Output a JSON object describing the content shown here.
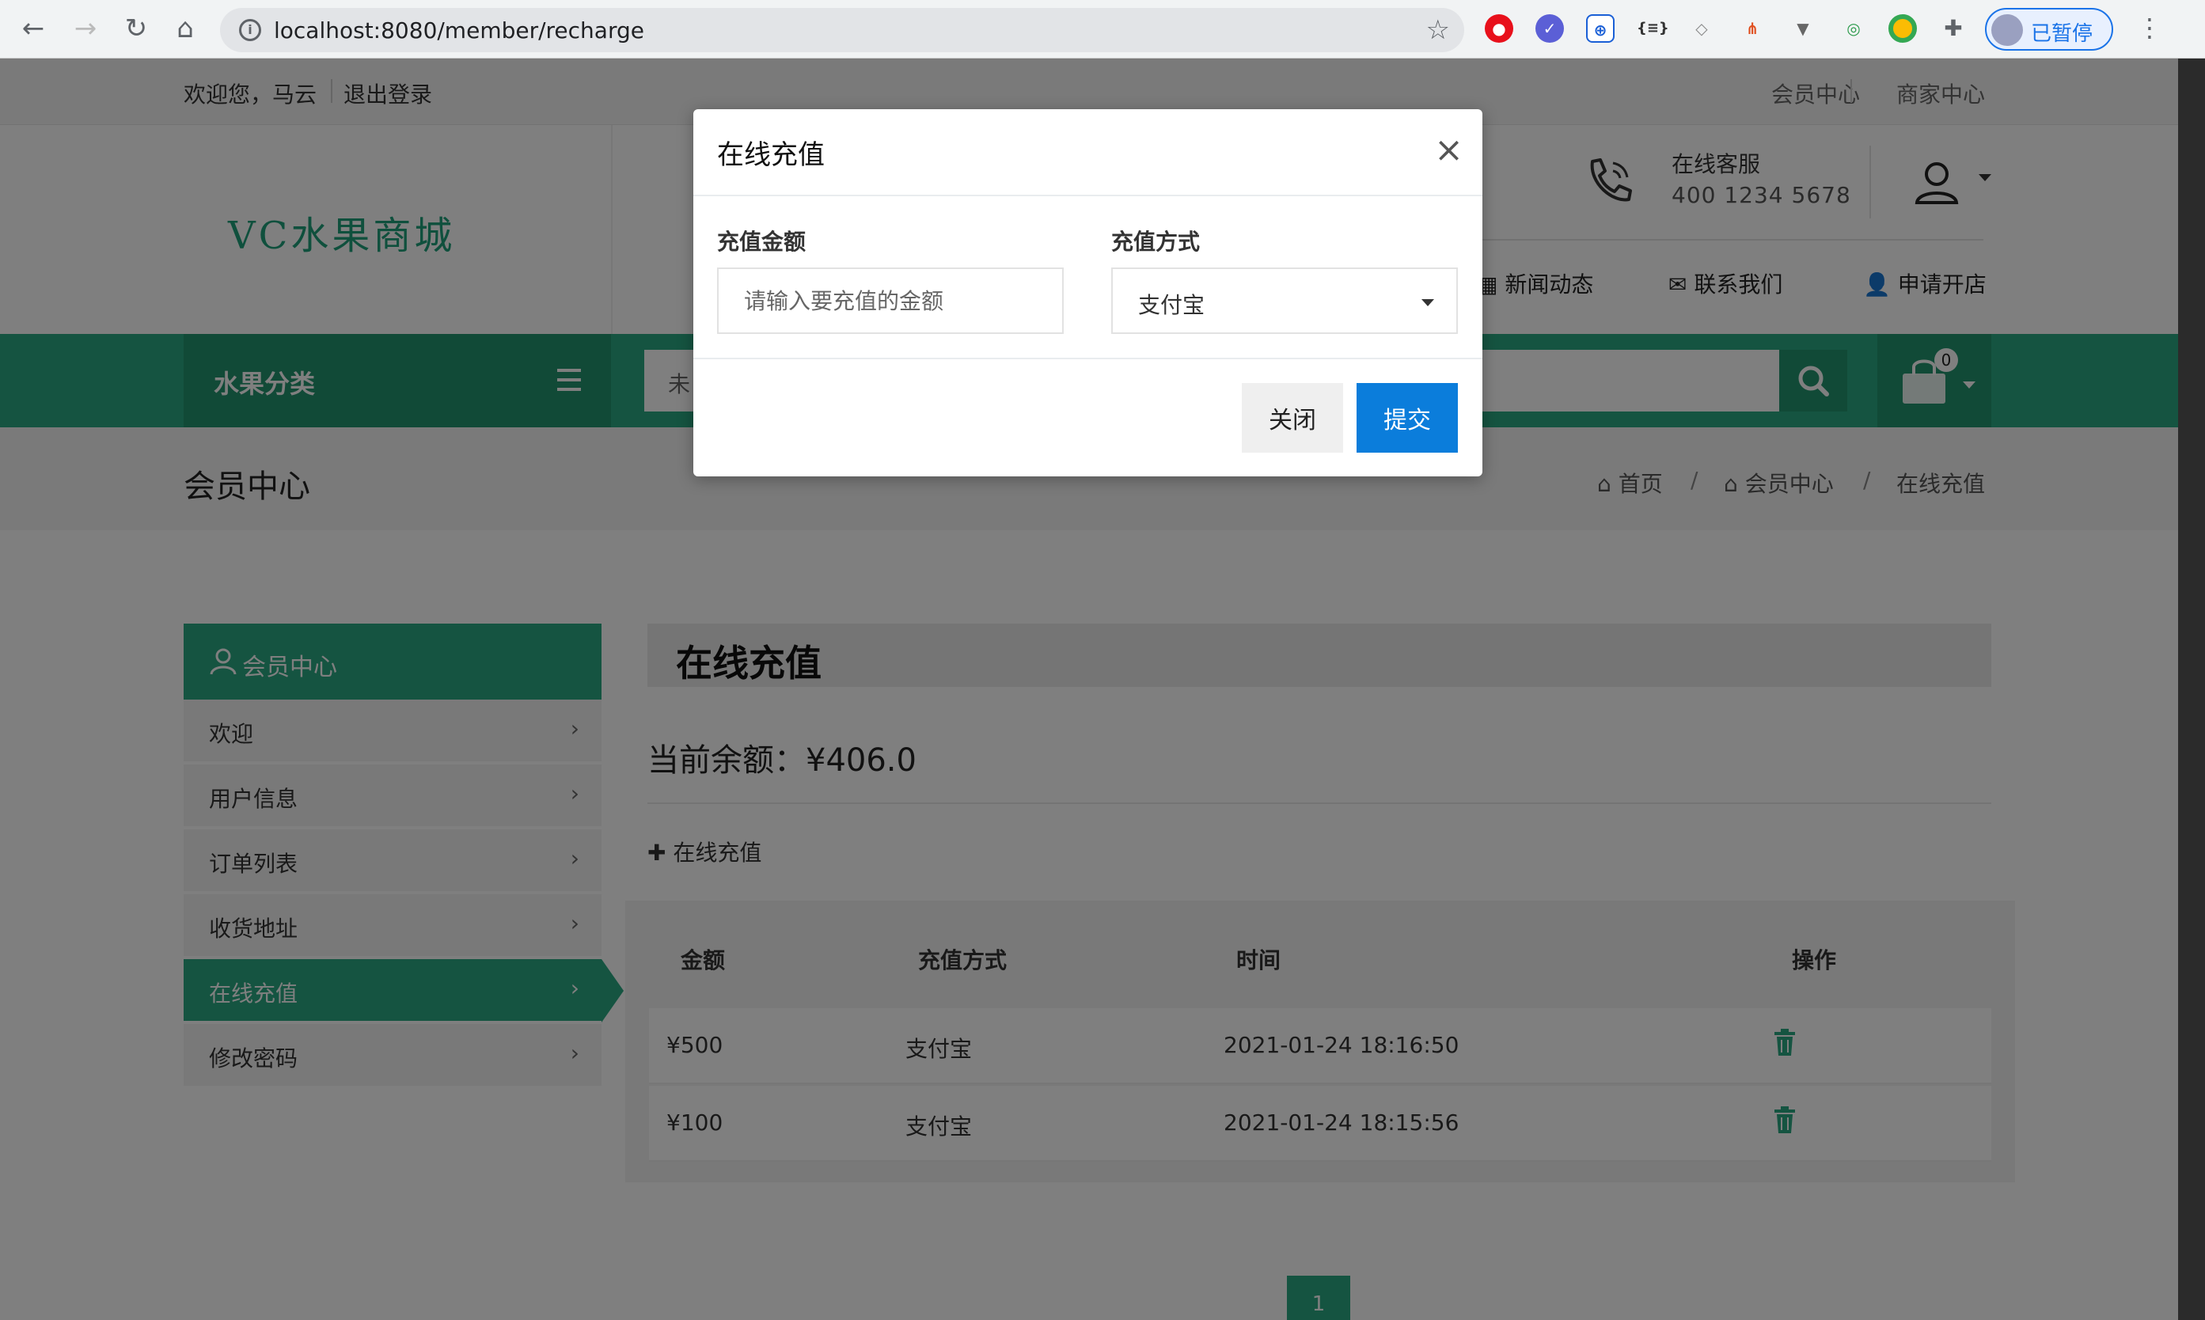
{
  "browser": {
    "url": "localhost:8080/member/recharge",
    "profile_label": "已暂停"
  },
  "topbar": {
    "welcome": "欢迎您，马云",
    "logout": "退出登录",
    "member_center": "会员中心",
    "merchant_center": "商家中心"
  },
  "header": {
    "logo": "VC水果商城",
    "service_title": "在线客服",
    "service_phone": "400 1234 5678",
    "nav": [
      "新闻动态",
      "联系我们",
      "申请开店"
    ]
  },
  "greenbar": {
    "category_label": "水果分类",
    "search_placeholder": "未",
    "cart_count": "0"
  },
  "crumbbar": {
    "title": "会员中心",
    "crumbs": [
      "首页",
      "会员中心",
      "在线充值"
    ],
    "separator": "/"
  },
  "sidebar": {
    "title": "会员中心",
    "items": [
      {
        "label": "欢迎"
      },
      {
        "label": "用户信息"
      },
      {
        "label": "订单列表"
      },
      {
        "label": "收货地址"
      },
      {
        "label": "在线充值"
      },
      {
        "label": "修改密码"
      }
    ]
  },
  "content": {
    "title": "在线充值",
    "balance": "当前余额：¥406.0",
    "add_link": "在线充值",
    "columns": [
      "金额",
      "充值方式",
      "时间",
      "操作"
    ],
    "rows": [
      {
        "amount": "¥500",
        "method": "支付宝",
        "time": "2021-01-24 18:16:50"
      },
      {
        "amount": "¥100",
        "method": "支付宝",
        "time": "2021-01-24 18:15:56"
      }
    ],
    "page": "1"
  },
  "modal": {
    "title": "在线充值",
    "amount_label": "充值金额",
    "amount_placeholder": "请输入要充值的金额",
    "method_label": "充值方式",
    "method_value": "支付宝",
    "close_button": "关闭",
    "submit_button": "提交"
  },
  "colors": {
    "primary_green": "#2aa882",
    "dark_green": "#23946f",
    "submit_blue": "#0b7ddb"
  }
}
